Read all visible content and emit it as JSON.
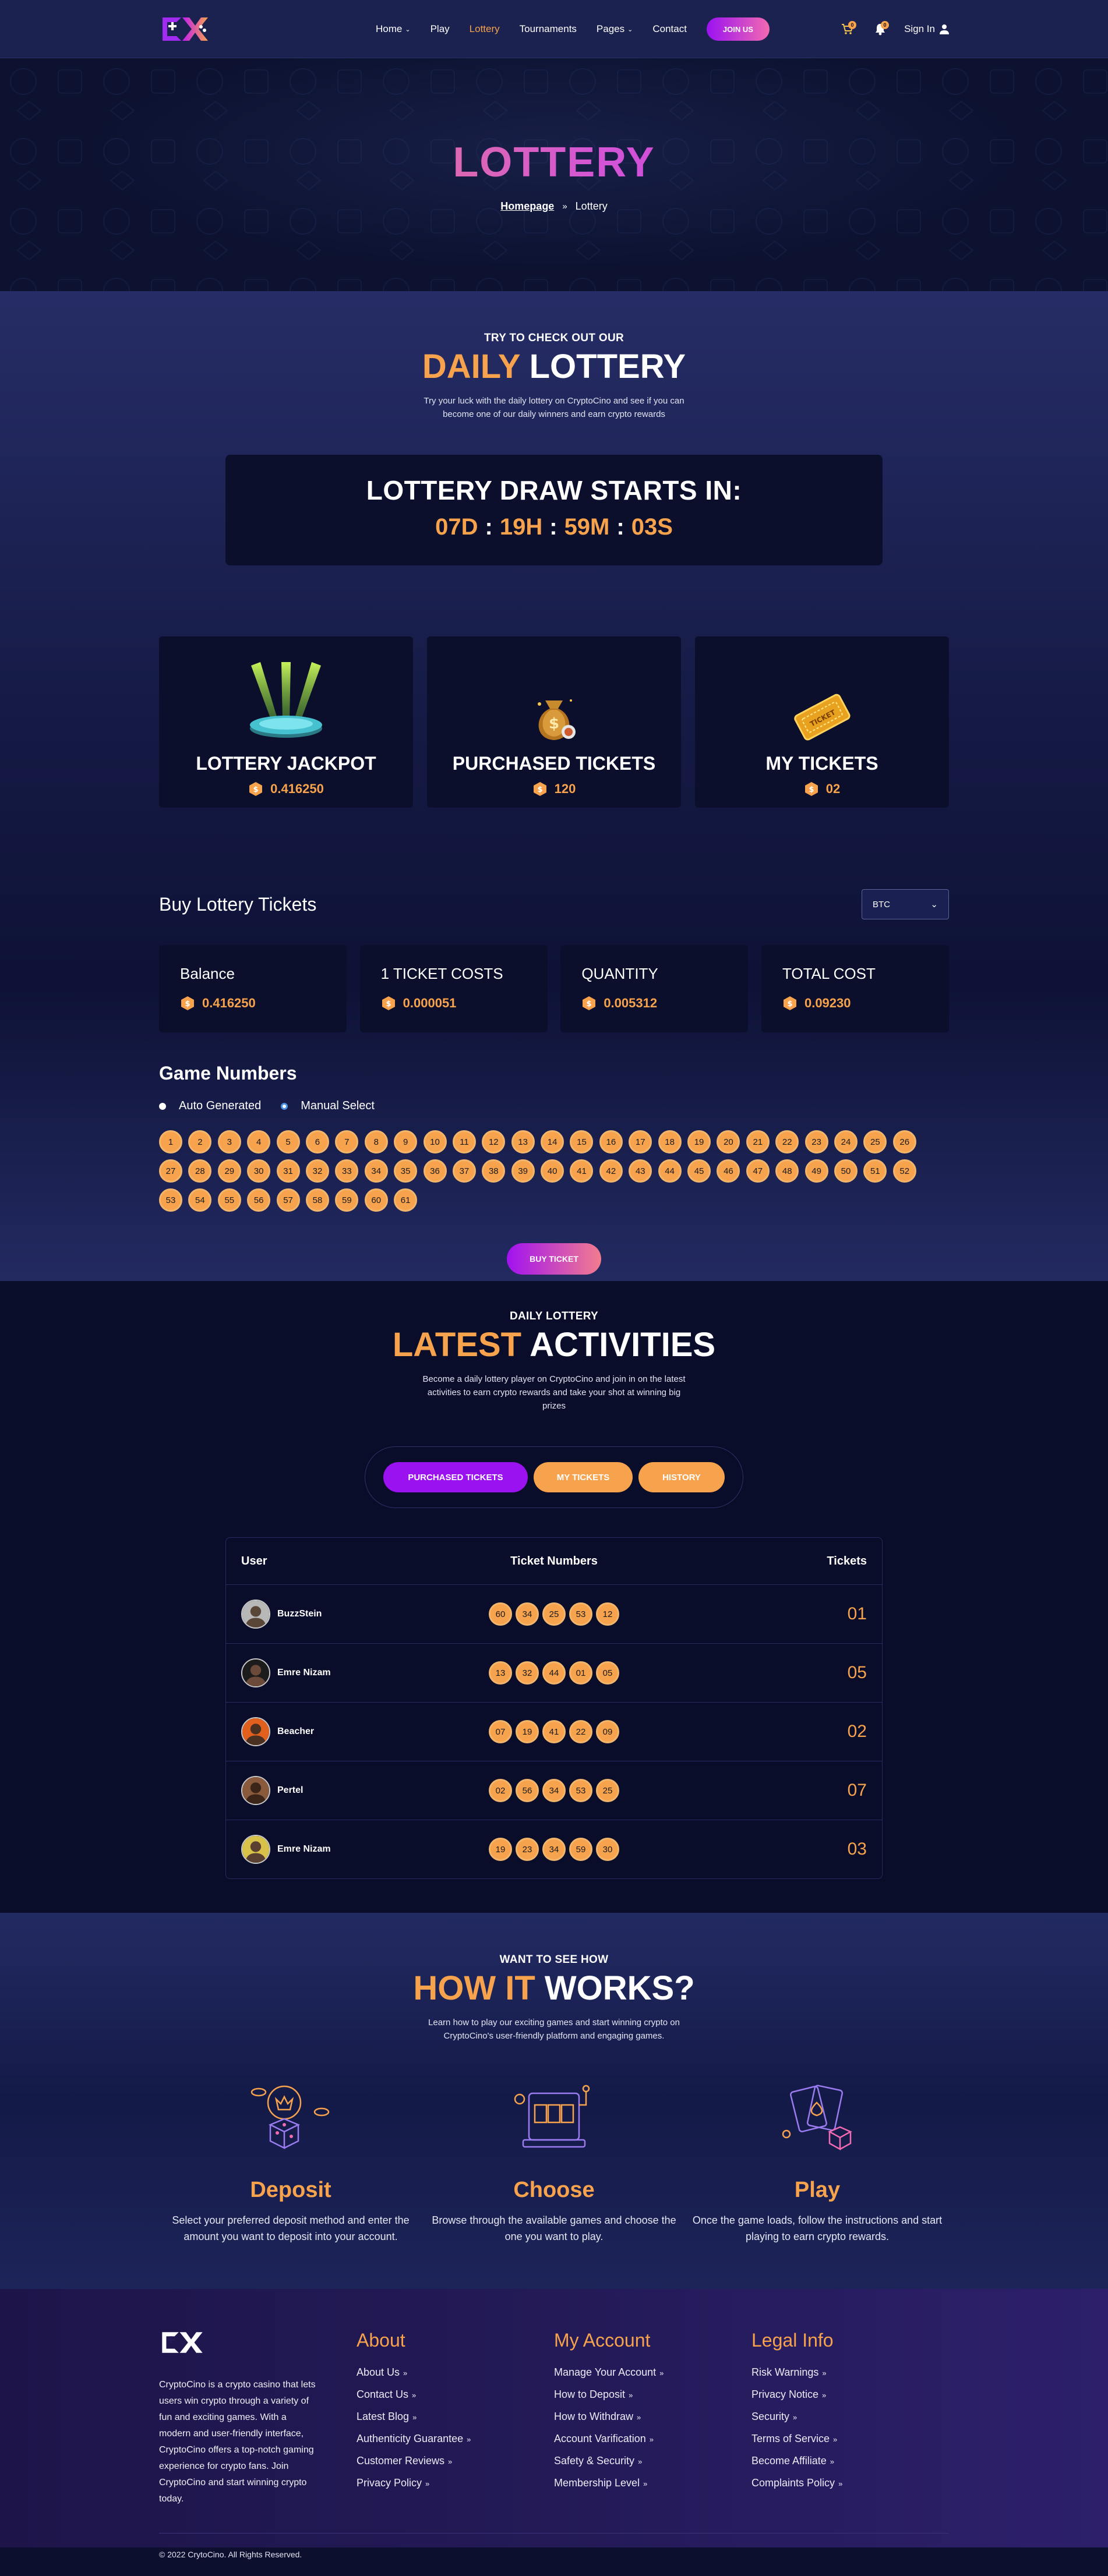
{
  "header": {
    "nav": [
      {
        "label": "Home",
        "dropdown": true
      },
      {
        "label": "Play",
        "dropdown": false
      },
      {
        "label": "Lottery",
        "dropdown": false,
        "active": true
      },
      {
        "label": "Tournaments",
        "dropdown": false
      },
      {
        "label": "Pages",
        "dropdown": true
      },
      {
        "label": "Contact",
        "dropdown": false
      }
    ],
    "join_label": "JOIN US",
    "cart_count": "0",
    "notif_count": "0",
    "signin_label": "Sign In"
  },
  "hero": {
    "title": "LOTTERY",
    "breadcrumb_home": "Homepage",
    "breadcrumb_sep": "»",
    "breadcrumb_current": "Lottery"
  },
  "daily": {
    "kicker": "TRY TO CHECK OUT OUR",
    "title_orange": "DAILY",
    "title_white": " LOTTERY",
    "subtitle": "Try your luck with the daily lottery on CryptoCino and see if you can become one of our daily winners and earn crypto rewards",
    "countdown_title": "LOTTERY DRAW STARTS IN:",
    "countdown": {
      "days": "07D",
      "hours": "19H",
      "minutes": "59M",
      "seconds": "03S"
    }
  },
  "stats": [
    {
      "label": "LOTTERY JACKPOT",
      "value": "0.416250"
    },
    {
      "label": "PURCHASED TICKETS",
      "value": "120"
    },
    {
      "label": "MY TICKETS",
      "value": "02"
    }
  ],
  "buy": {
    "title": "Buy Lottery Tickets",
    "currency": "BTC",
    "cards": [
      {
        "label": "Balance",
        "value": "0.416250"
      },
      {
        "label": "1 TICKET COSTS",
        "value": "0.000051"
      },
      {
        "label": "QUANTITY",
        "value": "0.005312"
      },
      {
        "label": "TOTAL COST",
        "value": "0.09230"
      }
    ],
    "game_title": "Game Numbers",
    "option_auto": "Auto Generated",
    "option_manual": "Manual Select",
    "numbers": [
      "1",
      "2",
      "3",
      "4",
      "5",
      "6",
      "7",
      "8",
      "9",
      "10",
      "11",
      "12",
      "13",
      "14",
      "15",
      "16",
      "17",
      "18",
      "19",
      "20",
      "21",
      "22",
      "23",
      "24",
      "25",
      "26",
      "27",
      "28",
      "29",
      "30",
      "31",
      "32",
      "33",
      "34",
      "35",
      "36",
      "37",
      "38",
      "39",
      "40",
      "41",
      "42",
      "43",
      "44",
      "45",
      "46",
      "47",
      "48",
      "49",
      "50",
      "51",
      "52",
      "53",
      "54",
      "55",
      "56",
      "57",
      "58",
      "59",
      "60",
      "61"
    ],
    "buy_label": "BUY TICKET"
  },
  "activities": {
    "kicker": "DAILY LOTTERY",
    "title_orange": "LATEST",
    "title_white": " ACTIVITIES",
    "subtitle": "Become a daily lottery player on CryptoCino and join in on the latest activities to earn crypto rewards and take your shot at winning big prizes",
    "tabs": [
      "PURCHASED TICKETS",
      "MY TICKETS",
      "HISTORY"
    ],
    "columns": [
      "User",
      "Ticket Numbers",
      "Tickets"
    ],
    "rows": [
      {
        "user": "BuzzStein",
        "numbers": [
          "60",
          "34",
          "25",
          "53",
          "12"
        ],
        "tickets": "01"
      },
      {
        "user": "Emre Nizam",
        "numbers": [
          "13",
          "32",
          "44",
          "01",
          "05"
        ],
        "tickets": "05"
      },
      {
        "user": "Beacher",
        "numbers": [
          "07",
          "19",
          "41",
          "22",
          "09"
        ],
        "tickets": "02"
      },
      {
        "user": "Pertel",
        "numbers": [
          "02",
          "56",
          "34",
          "53",
          "25"
        ],
        "tickets": "07"
      },
      {
        "user": "Emre Nizam",
        "numbers": [
          "19",
          "23",
          "34",
          "59",
          "30"
        ],
        "tickets": "03"
      }
    ]
  },
  "how": {
    "kicker": "WANT TO SEE HOW",
    "title_orange": "HOW IT",
    "title_white": " WORKS?",
    "subtitle": "Learn how to play our exciting games and start winning crypto on CryptoCino's user-friendly platform and engaging games.",
    "steps": [
      {
        "title": "Deposit",
        "desc": "Select your preferred deposit method and enter the amount you want to deposit into your account."
      },
      {
        "title": "Choose",
        "desc": "Browse through the available games and choose the one you want to play."
      },
      {
        "title": "Play",
        "desc": "Once the game loads, follow the instructions and start playing to earn crypto rewards."
      }
    ]
  },
  "footer": {
    "desc": "CryptoCino is a crypto casino that lets users win crypto through a variety of fun and exciting games. With a modern and user-friendly interface, CryptoCino offers a top-notch gaming experience for crypto fans. Join CryptoCino and start winning crypto today.",
    "cols": [
      {
        "title": "About",
        "links": [
          "About Us",
          "Contact Us",
          "Latest Blog",
          "Authenticity Guarantee",
          "Customer Reviews",
          "Privacy Policy"
        ]
      },
      {
        "title": "My Account",
        "links": [
          "Manage Your Account",
          "How to Deposit",
          "How to Withdraw",
          "Account Varification",
          "Safety & Security",
          "Membership Level"
        ]
      },
      {
        "title": "Legal Info",
        "links": [
          "Risk Warnings",
          "Privacy Notice",
          "Security",
          "Terms of Service",
          "Become Affiliate",
          "Complaints Policy"
        ]
      }
    ],
    "copyright": "© 2022 CrytoCino. All Rights Reserved."
  },
  "colors": {
    "accent": "#f7a24c",
    "purple": "#9a12f0",
    "dark": "#0b0f2b"
  }
}
